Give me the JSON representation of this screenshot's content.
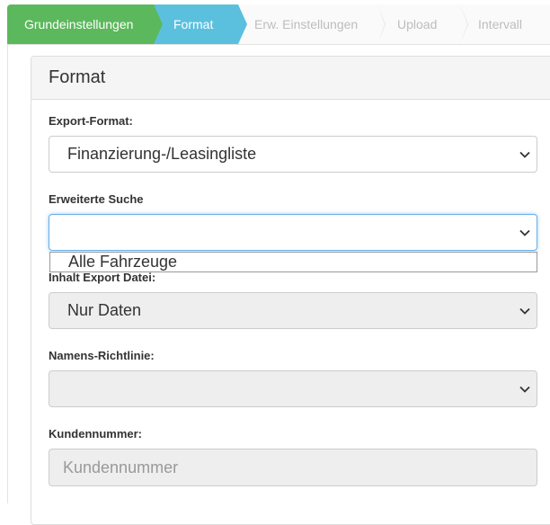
{
  "wizard": {
    "steps": [
      {
        "label": "Grundeinstellungen",
        "state": "done"
      },
      {
        "label": "Format",
        "state": "active"
      },
      {
        "label": "Erw. Einstellungen",
        "state": "todo"
      },
      {
        "label": "Upload",
        "state": "todo"
      },
      {
        "label": "Intervall",
        "state": "todo"
      }
    ]
  },
  "panel": {
    "title": "Format"
  },
  "form": {
    "export_format": {
      "label": "Export-Format:",
      "value": "Finanzierung-/Leasingliste"
    },
    "extended_search": {
      "label": "Erweiterte Suche",
      "value": "",
      "options": [
        "Alle Fahrzeuge"
      ]
    },
    "export_content": {
      "label": "Inhalt Export Datei:",
      "value": "Nur Daten"
    },
    "naming_policy": {
      "label": "Namens-Richtlinie:",
      "value": ""
    },
    "customer_number": {
      "label": "Kundennummer:",
      "placeholder": "Kundennummer"
    }
  },
  "colors": {
    "step_done": "#5cb85c",
    "step_active": "#5bc0de",
    "focus_border": "#66afe9"
  },
  "icons": {
    "select_arrow": "chevron-down-icon"
  }
}
